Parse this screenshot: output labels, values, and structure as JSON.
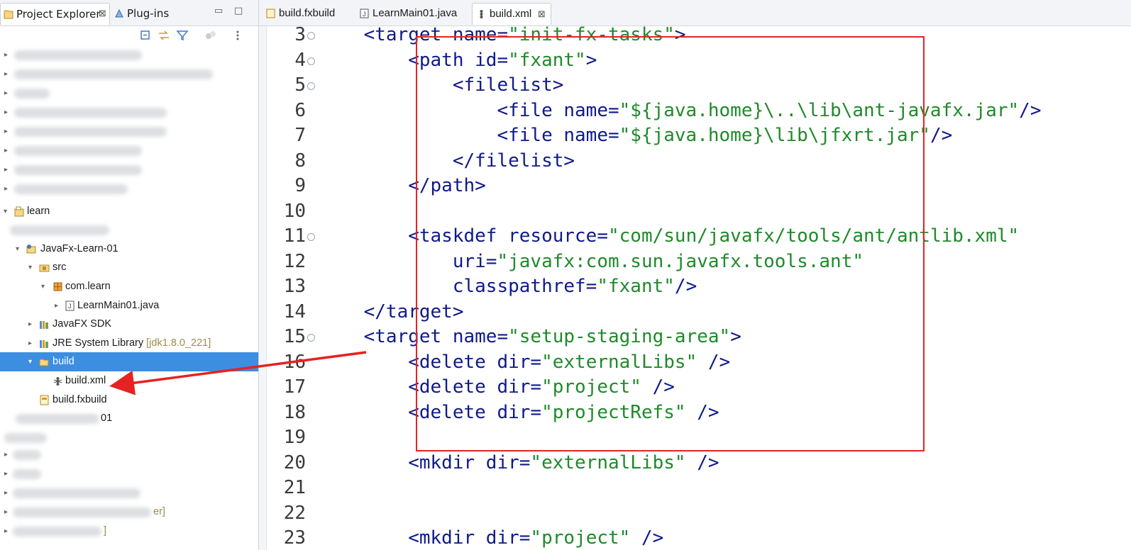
{
  "left_panel": {
    "tabs": [
      {
        "label": "Project Explorer",
        "close": "⊠"
      },
      {
        "label": "Plug-ins"
      }
    ],
    "window_controls": {
      "minimize": "▭",
      "maximize": "□"
    }
  },
  "tree": {
    "learn": "learn",
    "project": "JavaFx-Learn-01",
    "src": "src",
    "package": "com.learn",
    "java_file": "LearnMain01.java",
    "javafx_sdk": "JavaFX SDK",
    "jre": "JRE System Library",
    "jre_dec": "[jdk1.8.0_221]",
    "build_folder": "build",
    "build_xml": "build.xml",
    "build_fxbuild": "build.fxbuild",
    "partial_01": "01",
    "partial_er": "er]",
    "partial_bracket": "]"
  },
  "editor_tabs": [
    {
      "label": "build.fxbuild"
    },
    {
      "label": "LearnMain01.java"
    },
    {
      "label": "build.xml",
      "close": "⊠"
    }
  ],
  "code_lines": [
    {
      "n": "3",
      "fold": "⊖",
      "text": "    <target name=\"init-fx-tasks\">"
    },
    {
      "n": "4",
      "fold": "⊖",
      "text": "        <path id=\"fxant\">"
    },
    {
      "n": "5",
      "fold": "⊖",
      "text": "            <filelist>"
    },
    {
      "n": "6",
      "fold": "",
      "text": "                <file name=\"${java.home}\\..\\lib\\ant-javafx.jar\"/>"
    },
    {
      "n": "7",
      "fold": "",
      "text": "                <file name=\"${java.home}\\lib\\jfxrt.jar\"/>"
    },
    {
      "n": "8",
      "fold": "",
      "text": "            </filelist>"
    },
    {
      "n": "9",
      "fold": "",
      "text": "        </path>"
    },
    {
      "n": "10",
      "fold": "",
      "text": ""
    },
    {
      "n": "11",
      "fold": "⊖",
      "text": "        <taskdef resource=\"com/sun/javafx/tools/ant/antlib.xml\""
    },
    {
      "n": "12",
      "fold": "",
      "text": "            uri=\"javafx:com.sun.javafx.tools.ant\""
    },
    {
      "n": "13",
      "fold": "",
      "text": "            classpathref=\"fxant\"/>"
    },
    {
      "n": "14",
      "fold": "",
      "text": "    </target>"
    },
    {
      "n": "15",
      "fold": "⊖",
      "text": "    <target name=\"setup-staging-area\">"
    },
    {
      "n": "16",
      "fold": "",
      "text": "        <delete dir=\"externalLibs\" />"
    },
    {
      "n": "17",
      "fold": "",
      "text": "        <delete dir=\"project\" />"
    },
    {
      "n": "18",
      "fold": "",
      "text": "        <delete dir=\"projectRefs\" />"
    },
    {
      "n": "19",
      "fold": "",
      "text": ""
    },
    {
      "n": "20",
      "fold": "",
      "text": "        <mkdir dir=\"externalLibs\" />"
    },
    {
      "n": "21",
      "fold": "",
      "text": ""
    },
    {
      "n": "22",
      "fold": "",
      "text": ""
    },
    {
      "n": "23",
      "fold": "",
      "text": "        <mkdir dir=\"project\" />"
    }
  ],
  "colors": {
    "keyword": "#0f1a8a",
    "string": "#1f8a2a",
    "annotation": "#e62222",
    "selection": "#3c8fe0"
  }
}
